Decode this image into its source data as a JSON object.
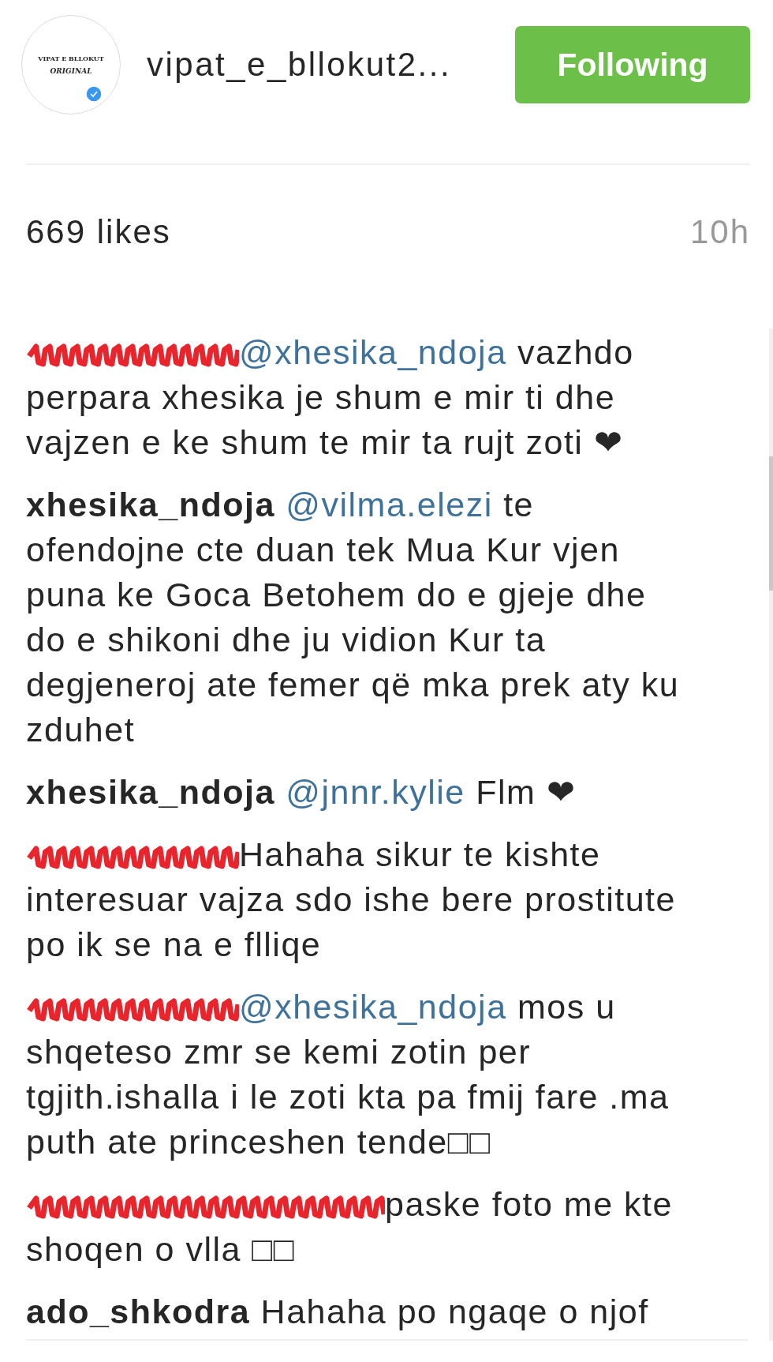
{
  "header": {
    "avatar": {
      "lines": [
        "VIPAT E BLLOKUT",
        "ORIGINAL"
      ],
      "verified": true
    },
    "username": "vipat_e_bllokut2...",
    "follow_button": {
      "label": "Following",
      "following": true
    }
  },
  "likes": "669 likes",
  "time": "10h",
  "comments": [
    {
      "redacted": true,
      "mention": "@xhesika_ndoja",
      "text": "vazhdo perpara xhesika je shum e mir ti dhe vajzen e ke shum te mir ta rujt zoti ❤"
    },
    {
      "user": "xhesika_ndoja",
      "mention": "@vilma.elezi",
      "text": "te ofendojne cte duan tek Mua Kur vjen puna ke Goca Betohem do e gjeje dhe do e shikoni dhe ju vidion Kur ta degjeneroj ate femer që mka prek aty ku zduhet"
    },
    {
      "user": "xhesika_ndoja",
      "mention": "@jnnr.kylie",
      "text": "Flm ❤"
    },
    {
      "redacted": true,
      "text": "Hahaha sikur te kishte interesuar vajza sdo ishe bere prostitute po ik se na e flliqe"
    },
    {
      "redacted": true,
      "mention": "@xhesika_ndoja",
      "text": "mos u shqeteso zmr se kemi zotin per tgjith.ishalla i le zoti kta pa fmij fare .ma puth ate princeshen tende□□"
    },
    {
      "redacted": true,
      "mention_redacted": true,
      "text": "paske foto me kte shoqen o vlla □□"
    },
    {
      "user": "ado_shkodra",
      "text": "Hahaha po ngaqe o njof"
    }
  ]
}
